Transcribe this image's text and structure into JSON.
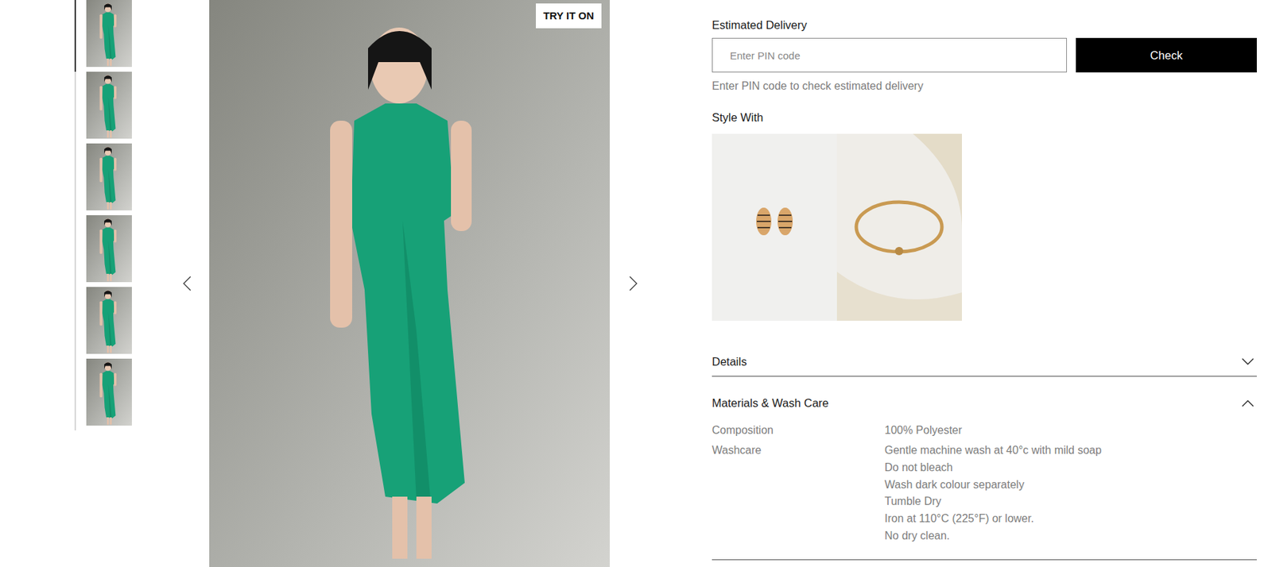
{
  "gallery": {
    "thumbnails": [
      {
        "selected": true
      },
      {
        "selected": false
      },
      {
        "selected": false
      },
      {
        "selected": false
      },
      {
        "selected": false
      },
      {
        "selected": false
      }
    ],
    "badge": "TRY IT ON"
  },
  "delivery": {
    "title": "Estimated Delivery",
    "placeholder": "Enter PIN code",
    "button": "Check",
    "hint": "Enter PIN code to check estimated delivery"
  },
  "style_with": {
    "title": "Style With"
  },
  "accordion": [
    {
      "title": "Details",
      "expanded": false,
      "rows": []
    },
    {
      "title": "Materials & Wash Care",
      "expanded": true,
      "rows": [
        {
          "label": "Composition",
          "values": [
            "100% Polyester"
          ]
        },
        {
          "label": "Washcare",
          "values": [
            "Gentle machine wash at 40°c with mild soap",
            "Do not bleach",
            "Wash dark colour separately",
            "Tumble Dry",
            "Iron at 110°C (225°F) or lower.",
            "No dry clean."
          ]
        }
      ]
    }
  ]
}
